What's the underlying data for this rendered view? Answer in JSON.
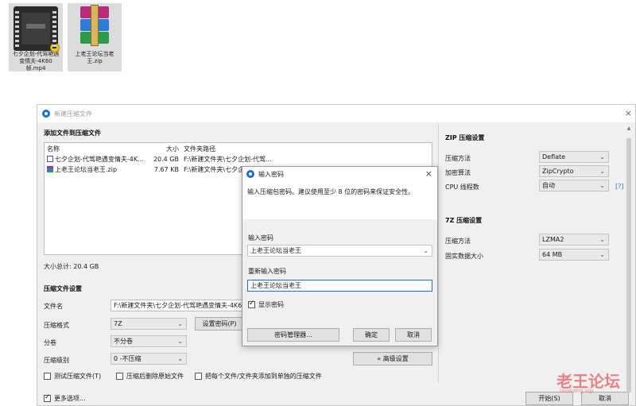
{
  "desktop": {
    "icons": [
      {
        "label": "七夕企划-代驾艳遇变情夫-4K60帧.mp4",
        "icon": "video-file-icon"
      },
      {
        "label": "上老王论坛当老王.zip",
        "icon": "winrar-archive-icon"
      }
    ]
  },
  "main_window": {
    "title": "新建压缩文件",
    "add_files_title": "添加文件到压缩文件",
    "columns": {
      "name": "名称",
      "size": "大小",
      "path": "文件夹路径"
    },
    "files": [
      {
        "name": "七夕企划-代驾艳遇变情夫-4K...",
        "size": "20.4 GB",
        "path": "F:\\新建文件夹\\七夕企划-代驾...",
        "icon": "video-file-icon"
      },
      {
        "name": "上老王论坛当老王.zip",
        "size": "7.67 KB",
        "path": "F:\\新建文件夹\\七夕企划-代驾...",
        "icon": "zip-file-icon"
      }
    ],
    "total_size": "大小总计: 20.4 GB",
    "settings_title": "压缩文件设置",
    "filename_label": "文件名",
    "filename_value": "F:\\新建文件夹\\七夕企划-代驾艳遇变情夫-4K60",
    "format_label": "压缩格式",
    "format_value": "7Z",
    "set_password_label": "设置密码(P)",
    "split_label": "分卷",
    "split_value": "不分卷",
    "level_label": "压缩级别",
    "level_value": "0 -不压缩",
    "advanced_label": "« 高级设置",
    "options": [
      {
        "label": "测试压缩文件(T)",
        "checked": false
      },
      {
        "label": "压缩后删除原始文件",
        "checked": false
      },
      {
        "label": "把每个文件/文件夹添加到单独的压缩文件",
        "checked": false
      }
    ],
    "more_options_label": "更多选项...",
    "more_options_checked": true,
    "start_label": "开始(S)",
    "cancel_label": "取消"
  },
  "zip_settings": {
    "title": "ZIP 压缩设置",
    "method_label": "压缩方法",
    "method_value": "Deflate",
    "encrypt_label": "加密算法",
    "encrypt_value": "ZipCrypto",
    "threads_label": "CPU 线程数",
    "threads_value": "自动",
    "help_label": "[?]"
  },
  "sevenz_settings": {
    "title": "7Z 压缩设置",
    "method_label": "压缩方法",
    "method_value": "LZMA2",
    "solid_label": "固实数据大小",
    "solid_value": "64 MB"
  },
  "password_dialog": {
    "title": "输入密码",
    "info": "输入压缩包密码。建议使用至少 8 位的密码来保证安全性。",
    "password_label": "输入密码",
    "password_value": "上老王论坛当老王",
    "confirm_label": "重新输入密码",
    "confirm_value": "上老王论坛当老王",
    "show_password_label": "显示密码",
    "show_password_checked": true,
    "manager_label": "密码管理器...",
    "ok_label": "确定",
    "cancel_label": "取消"
  },
  "watermark": {
    "text": "老王论坛",
    "sub": "laowang.vip"
  },
  "colors": {
    "accent": "#1f6fd1",
    "watermark": "#dc2828"
  }
}
